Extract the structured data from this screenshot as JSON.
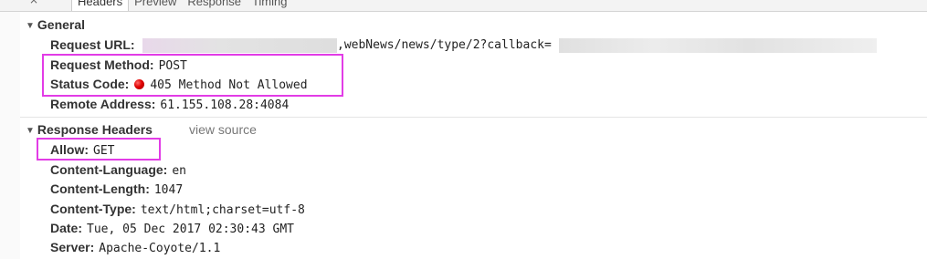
{
  "tabs": [
    "Headers",
    "Preview",
    "Response",
    "Timing"
  ],
  "general": {
    "title": "General",
    "request_url": {
      "label": "Request URL:",
      "value": ",webNews/news/type/2?callback="
    },
    "request_method": {
      "label": "Request Method:",
      "value": "POST"
    },
    "status_code": {
      "label": "Status Code:",
      "value": "405 Method Not Allowed"
    },
    "remote_address": {
      "label": "Remote Address:",
      "value": "61.155.108.28:4084"
    }
  },
  "response_headers": {
    "title": "Response Headers",
    "view_source": "view source",
    "items": [
      {
        "label": "Allow:",
        "value": "GET"
      },
      {
        "label": "Content-Language:",
        "value": "en"
      },
      {
        "label": "Content-Length:",
        "value": "1047"
      },
      {
        "label": "Content-Type:",
        "value": "text/html;charset=utf-8"
      },
      {
        "label": "Date:",
        "value": "Tue, 05 Dec 2017 02:30:43 GMT"
      },
      {
        "label": "Server:",
        "value": "Apache-Coyote/1.1"
      }
    ]
  },
  "colors": {
    "highlight": "#e23ce6",
    "status_dot": "#e00000"
  }
}
